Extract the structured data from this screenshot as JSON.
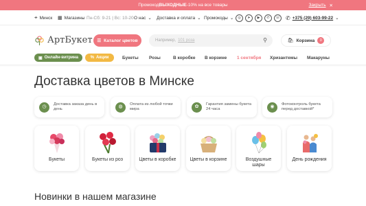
{
  "promo": {
    "prefix": "Промокод ",
    "code": "ВЫХОДНЫЕ",
    "suffix": " -10% на все товары",
    "close_label": "Закрыть",
    "close_x": "✕"
  },
  "topbar": {
    "city": "Минск",
    "stores": "Магазины",
    "hours": "Пн-Сб: 9-21 | Вс: 10-20",
    "about": "О нас",
    "delivery": "Доставка и оплата",
    "promocodes": "Промокоды",
    "phone": "+375 (29) 603-99-22"
  },
  "header": {
    "logo": "АртБукет",
    "catalog": "Каталог цветов",
    "search_prefix": "Например,",
    "search_example": "101 роза",
    "cart": "Корзина",
    "cart_count": "0"
  },
  "nav": {
    "showcase": "Онлайн-витрина",
    "sales": "Акции",
    "items": [
      "Букеты",
      "Розы",
      "В коробке",
      "В корзине",
      "1 сентября",
      "Хризантемы",
      "Макаруны"
    ]
  },
  "page_title": "Доставка цветов в Минске",
  "features": [
    {
      "line1": "Доставка заказа день в",
      "line2": "день"
    },
    {
      "line1": "Оплата из любой точки",
      "line2": "мира"
    },
    {
      "line1": "Гарантия замены букета",
      "line2": "24 часа"
    },
    {
      "line1": "Фотоконтроль букета",
      "line2": "перед доставкой*"
    }
  ],
  "categories": [
    {
      "line1": "Букеты",
      "line2": ""
    },
    {
      "line1": "Букеты из роз",
      "line2": ""
    },
    {
      "line1": "Цветы в коробке",
      "line2": ""
    },
    {
      "line1": "Цветы в корзине",
      "line2": ""
    },
    {
      "line1": "Воздушные",
      "line2": "шары"
    },
    {
      "line1": "День рождения",
      "line2": ""
    }
  ],
  "section_title": "Новинки в нашем магазине",
  "colors": {
    "accent": "#f0767f",
    "green": "#6b8f4e",
    "yellow": "#f2b944"
  }
}
